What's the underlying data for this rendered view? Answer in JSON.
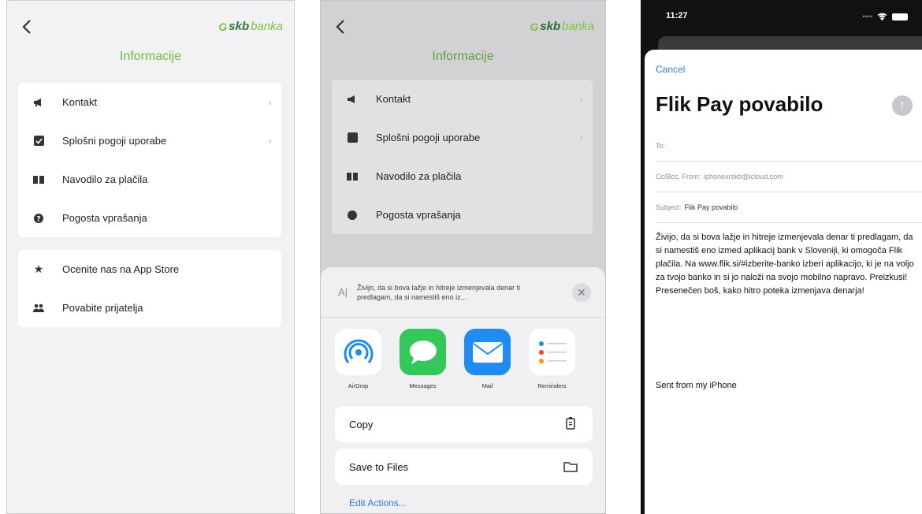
{
  "screen1": {
    "logo": {
      "mark": "G",
      "text_bold": "skb",
      "text_light": "banka"
    },
    "title": "Informacije",
    "menu_top": [
      {
        "label": "Kontakt",
        "icon": "megaphone-icon",
        "chevron": "›"
      },
      {
        "label": "Splošni pogoji uporabe",
        "icon": "checkbox-icon",
        "chevron": "›"
      },
      {
        "label": "Navodilo za plačila",
        "icon": "book-icon",
        "chevron": ""
      },
      {
        "label": "Pogosta vprašanja",
        "icon": "question-icon",
        "chevron": ""
      }
    ],
    "menu_bottom": [
      {
        "label": "Ocenite nas na App Store",
        "icon": "star-icon"
      },
      {
        "label": "Povabite prijatelja",
        "icon": "users-icon"
      }
    ]
  },
  "screen2": {
    "logo": {
      "mark": "G",
      "text_bold": "skb",
      "text_light": "banka"
    },
    "title": "Informacije",
    "menu_top": [
      {
        "label": "Kontakt",
        "chevron": "›"
      },
      {
        "label": "Splošni pogoji uporabe",
        "chevron": "›"
      },
      {
        "label": "Navodilo za plačila",
        "chevron": ""
      },
      {
        "label": "Pogosta vprašanja",
        "chevron": ""
      }
    ],
    "share_sheet": {
      "preview_glyph": "A|",
      "preview_text": "Živijo, da si bova lažje in hitreje izmenjevala denar ti predlagam, da si namestiš eno iz...",
      "close_glyph": "✕",
      "apps": [
        {
          "name": "AirDrop",
          "icon": "airdrop-icon",
          "color": "#1c8cf0"
        },
        {
          "name": "Messages",
          "icon": "messages-icon",
          "color": "#34c759"
        },
        {
          "name": "Mail",
          "icon": "mail-icon",
          "color": "#1e8cf0"
        },
        {
          "name": "Reminders",
          "icon": "reminders-icon",
          "color": "#ffffff"
        }
      ],
      "actions": [
        {
          "label": "Copy",
          "icon": "copy-icon"
        },
        {
          "label": "Save to Files",
          "icon": "folder-icon"
        }
      ],
      "edit_actions": "Edit Actions..."
    }
  },
  "screen3": {
    "time": "11:27",
    "cancel": "Cancel",
    "subject_title": "Flik Pay povabilo",
    "to_label": "To:",
    "cc_label": "Cc/Bcc, From:",
    "from_value": "iphonexrskb@icloud.com",
    "subject_label": "Subject:",
    "subject_value": "Flik Pay povabilo",
    "body": "Živijo, da si bova lažje in hitreje izmenjevala denar ti predlagam, da si namestiš eno izmed aplikacij bank v Sloveniji, ki omogoča Flik plačila. Na www.flik.si/#izberite-banko izberi aplikacijo, ki je na voljo za tvojo banko in si jo naloži na svojo mobilno napravo. Preizkusi! Presenečen boš, kako hitro poteka izmenjava denarja!",
    "signature": "Sent from my iPhone",
    "send_icon": "send-arrow-icon"
  },
  "colors": {
    "brand_green": "#6abf3a",
    "ios_blue": "#2f7ae0"
  }
}
